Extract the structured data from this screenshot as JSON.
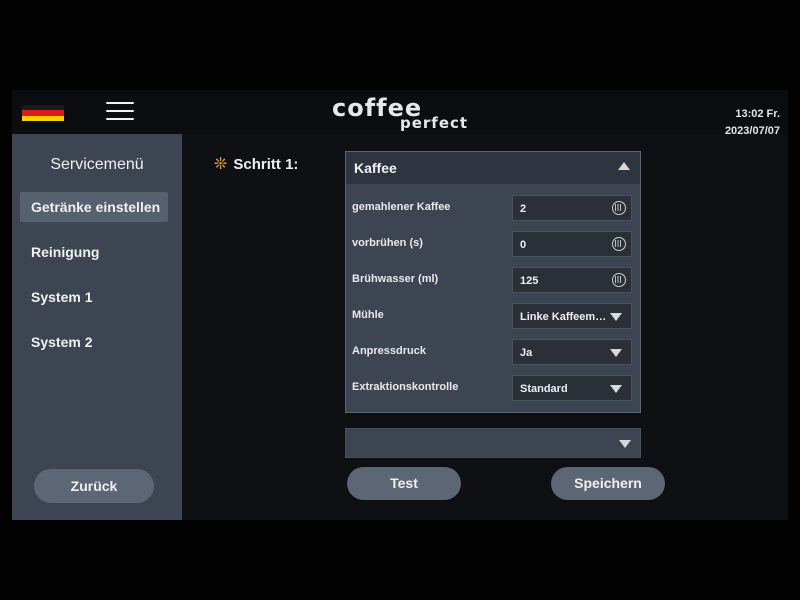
{
  "header": {
    "language_flag": "germany-flag",
    "logo_line1": "coffee",
    "logo_line2": "perfect",
    "time": "13:02 Fr.",
    "date": "2023/07/07"
  },
  "sidebar": {
    "title": "Servicemenü",
    "items": [
      {
        "label": "Getränke einstellen",
        "active": true
      },
      {
        "label": "Reinigung",
        "active": false
      },
      {
        "label": "System 1",
        "active": false
      },
      {
        "label": "System 2",
        "active": false
      }
    ],
    "back_label": "Zurück"
  },
  "main": {
    "step_label": "Schritt 1:",
    "step_icon": "sparkle-icon",
    "panel": {
      "title": "Kaffee",
      "rows": [
        {
          "label": "gemahlener Kaffee",
          "value": "2",
          "control": "keypad-icon"
        },
        {
          "label": "vorbrühen (s)",
          "value": "0",
          "control": "keypad-icon"
        },
        {
          "label": "Brühwasser (ml)",
          "value": "125",
          "control": "keypad-icon"
        },
        {
          "label": "Mühle",
          "value": "Linke Kaffeemü...",
          "control": "dropdown"
        },
        {
          "label": "Anpressdruck",
          "value": "Ja",
          "control": "dropdown"
        },
        {
          "label": "Extraktionskontrolle",
          "value": "Standard",
          "control": "dropdown"
        }
      ]
    },
    "step2_value": "",
    "test_label": "Test",
    "save_label": "Speichern"
  },
  "colors": {
    "accent": "#e8a040",
    "panel": "#3e4552",
    "button": "#5c6675"
  }
}
